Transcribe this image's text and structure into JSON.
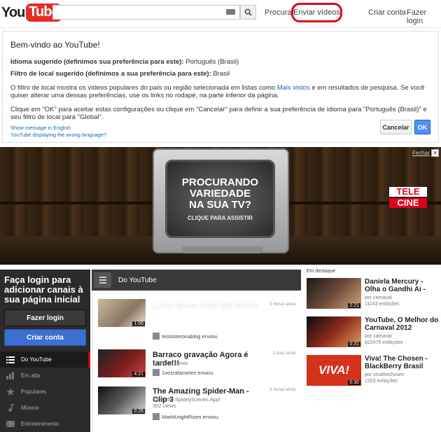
{
  "header": {
    "logo_you": "You",
    "logo_tube": "Tube",
    "search_placeholder": "",
    "search_button": "search-icon",
    "link_search": "Procurar",
    "link_upload": "Enviar vídeos",
    "link_create": "Criar conta",
    "link_login": "Fazer login"
  },
  "welcome": {
    "title": "Bem-vindo ao YouTube!",
    "lang_label": "Idioma sugerido (definimos sua preferência para este):",
    "lang_value": "Português (Brasil)",
    "filter_label": "Filtro de local sugerido (definimos a sua preferência para este):",
    "filter_value": "Brasil",
    "para1_a": "O filtro de local mostra os vídeos populares do país ou região selecionada em listas como ",
    "para1_link": "Mais vistos",
    "para1_b": " e em resultados de pesquisa. Se você quiser alterar uma dessas preferências, use os links no rodapé, na parte inferior da página.",
    "para2": "Clique em \"OK\" para aceitar estas configurações ou clique em \"Cancelar\" para definir a sua preferência de idioma para \"Português (Brasil)\" e seu filtro de local para \"Global\".",
    "link_english": "Show message in English",
    "link_wrong_lang": "YouTube displaying the wrong language?",
    "btn_cancel": "Cancelar",
    "btn_ok": "OK"
  },
  "banner": {
    "close_label": "Fechar",
    "close_x": "✕",
    "tv_line1": "PROCURANDO",
    "tv_line2": "VARIEDADE",
    "tv_line3": "NA SUA TV?",
    "tv_sub": "CLIQUE PARA ASSISTIR",
    "brand_top": "TELE",
    "brand_bottom": "CINE"
  },
  "sidebar": {
    "title": "Faça login para adicionar canais à sua página inicial",
    "btn_login": "Fazer login",
    "btn_create": "Criar conta",
    "items": [
      {
        "label": "Do YouTube",
        "icon": "list-icon",
        "active": true
      },
      {
        "label": "Em alta",
        "icon": "trending-icon",
        "active": false
      },
      {
        "label": "Populares",
        "icon": "star-icon",
        "active": false
      },
      {
        "label": "Música",
        "icon": "music-icon",
        "active": false
      },
      {
        "label": "Entretenimento",
        "icon": "film-icon",
        "active": false
      }
    ]
  },
  "feed": {
    "title": "Do YouTube",
    "videos": [
      {
        "title": "Lorem Ipsum video title blurred",
        "meta": "",
        "time": "5 horas atrás",
        "duration": "1:06",
        "uploader": "testosteronablog enviou"
      },
      {
        "title": "Barraco gravação Agora é tarde!!!",
        "meta": "1283573 views",
        "time": "3 dias atrás",
        "duration": "4:21",
        "uploader": "1vezrafacortez enviou"
      },
      {
        "title": "The Amazing Spider-Man - Clip 3",
        "meta": "From the SpideyScenes App!",
        "meta2": "302 views",
        "time": "6 horas atrás",
        "duration": "0:26",
        "uploader": "MarkKnightRises enviou"
      }
    ]
  },
  "featured": {
    "title": "Em destaque",
    "items": [
      {
        "title": "Daniela Mercury - Olha o Gandhi Ai -",
        "by": "por carnaval",
        "views": "11143 exibições",
        "duration": "2:21"
      },
      {
        "title": "YouTube, O Melhor do Carnaval 2012",
        "by": "por carnaval",
        "views": "822476 exibições",
        "duration": "0:31"
      },
      {
        "title": "Viva! The Chosen - BlackBerry Brasil",
        "by": "por vivathechosen",
        "views": "1203 exibições",
        "duration": "0:30",
        "thumb_text": "VIVA!"
      }
    ]
  },
  "colors": {
    "brand_red": "#e52d27",
    "highlight_red": "#e0001b",
    "link_blue": "#1c62b9",
    "ok_blue": "#4d90fe",
    "sidebar_bg": "#2b2b2b"
  }
}
